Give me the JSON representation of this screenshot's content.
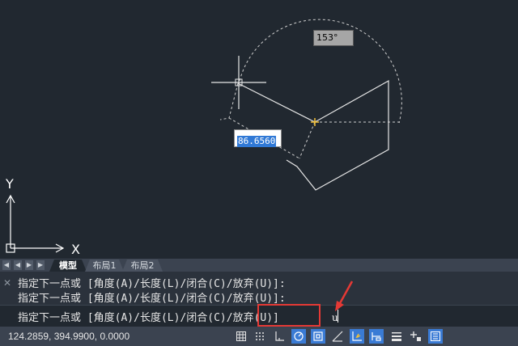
{
  "drawing": {
    "angle_tooltip": "153°",
    "length_input": "86.6560",
    "ucs_y_label": "Y",
    "ucs_x_label": "X"
  },
  "tabs": {
    "nav": [
      "◀",
      "◀",
      "▶",
      "▶"
    ],
    "items": [
      {
        "label": "模型",
        "active": true
      },
      {
        "label": "布局1",
        "active": false
      },
      {
        "label": "布局2",
        "active": false
      }
    ]
  },
  "command": {
    "close_glyph": "✕",
    "history": [
      "指定下一点或 [角度(A)/长度(L)/闭合(C)/放弃(U)]:",
      "指定下一点或 [角度(A)/长度(L)/闭合(C)/放弃(U)]:"
    ],
    "prompt_before": "指定下一点或 [角度(A)/长度(L)/闭合(C)",
    "prompt_highlight": "/放弃(U)]",
    "typed": "u"
  },
  "status": {
    "coordinates": "124.2859, 394.9900, 0.0000",
    "buttons": [
      {
        "icon": "grid-icon",
        "on": false
      },
      {
        "icon": "snap-icon",
        "on": false
      },
      {
        "icon": "ortho-icon",
        "on": false
      },
      {
        "icon": "polar-icon",
        "on": true
      },
      {
        "icon": "osnap-icon",
        "on": true
      },
      {
        "icon": "otrack-icon",
        "on": false
      },
      {
        "icon": "dynamic-ucs-icon",
        "on": true
      },
      {
        "icon": "dynamic-input-icon",
        "on": true
      },
      {
        "icon": "lineweight-icon",
        "on": false
      },
      {
        "icon": "add-icon",
        "on": false
      },
      {
        "icon": "customize-icon",
        "on": true
      }
    ]
  },
  "colors": {
    "canvas": "#212830",
    "highlight_box": "#e53935",
    "arrow": "#e53935",
    "active_toggle": "#3a7bd5"
  }
}
